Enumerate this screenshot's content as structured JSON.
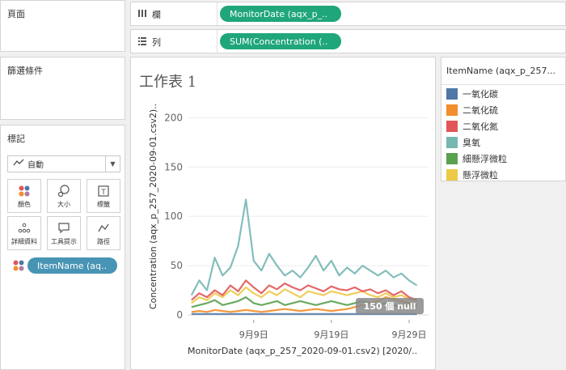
{
  "pages": {
    "title": "頁面"
  },
  "filters": {
    "title": "篩選條件"
  },
  "marks": {
    "title": "標記",
    "type": "自動",
    "buttons": [
      {
        "label": "顏色",
        "icon": "color-icon"
      },
      {
        "label": "大小",
        "icon": "size-icon"
      },
      {
        "label": "標籤",
        "icon": "label-icon"
      },
      {
        "label": "詳細資料",
        "icon": "detail-icon"
      },
      {
        "label": "工具提示",
        "icon": "tooltip-icon"
      },
      {
        "label": "路徑",
        "icon": "path-icon"
      }
    ],
    "color_pill": "ItemName (aq.."
  },
  "columns": {
    "label": "欄",
    "pill": "MonitorDate (aqx_p_.."
  },
  "rows": {
    "label": "列",
    "pill": "SUM(Concentration (.."
  },
  "sheet": {
    "title": "工作表 1",
    "null_badge": "150 個 null"
  },
  "legend": {
    "title": "ItemName (aqx_p_257...",
    "items": [
      {
        "label": "一氧化碳",
        "color": "#4e79a7"
      },
      {
        "label": "二氧化硫",
        "color": "#f28e2b"
      },
      {
        "label": "二氧化氮",
        "color": "#e15759"
      },
      {
        "label": "臭氧",
        "color": "#76b7b2"
      },
      {
        "label": "細懸浮微粒",
        "color": "#59a14f"
      },
      {
        "label": "懸浮微粒",
        "color": "#edc948"
      }
    ]
  },
  "chart_data": {
    "type": "line",
    "xlabel": "MonitorDate (aqx_p_257_2020-09-01.csv2) [2020/..",
    "ylabel": "Concentration (aqx_p_257_2020-09-01.csv2)..",
    "x_ticks": [
      "9月9日",
      "9月19日",
      "9月29日"
    ],
    "y_ticks": [
      0,
      50,
      100,
      150,
      200
    ],
    "ylim": [
      0,
      220
    ],
    "x": [
      1,
      2,
      3,
      4,
      5,
      6,
      7,
      8,
      9,
      10,
      11,
      12,
      13,
      14,
      15,
      16,
      17,
      18,
      19,
      20,
      21,
      22,
      23,
      24,
      25,
      26,
      27,
      28,
      29,
      30
    ],
    "x_tick_positions": [
      9,
      19,
      29
    ],
    "series": [
      {
        "name": "一氧化碳",
        "values": [
          1,
          1,
          1,
          1,
          1,
          1,
          1,
          1,
          1,
          1,
          1,
          1,
          1,
          1,
          1,
          1,
          1,
          1,
          1,
          1,
          1,
          1,
          1,
          1,
          1,
          1,
          1,
          1,
          1,
          1
        ]
      },
      {
        "name": "二氧化硫",
        "values": [
          3,
          4,
          3,
          5,
          4,
          3,
          4,
          5,
          4,
          3,
          4,
          5,
          6,
          5,
          4,
          5,
          6,
          5,
          4,
          5,
          6,
          8,
          10,
          12,
          14,
          18,
          16,
          14,
          12,
          10
        ]
      },
      {
        "name": "二氧化氮",
        "values": [
          15,
          22,
          18,
          25,
          20,
          30,
          24,
          35,
          28,
          22,
          30,
          26,
          32,
          28,
          25,
          30,
          27,
          24,
          29,
          26,
          25,
          28,
          24,
          26,
          22,
          25,
          20,
          24,
          18,
          15
        ]
      },
      {
        "name": "臭氧",
        "values": [
          20,
          35,
          25,
          58,
          40,
          48,
          70,
          117,
          55,
          45,
          62,
          50,
          40,
          45,
          38,
          48,
          60,
          45,
          55,
          40,
          48,
          42,
          50,
          45,
          40,
          45,
          38,
          42,
          35,
          30
        ]
      },
      {
        "name": "細懸浮微粒",
        "values": [
          8,
          10,
          12,
          15,
          10,
          12,
          14,
          18,
          12,
          10,
          12,
          14,
          10,
          12,
          14,
          12,
          10,
          12,
          14,
          12,
          10,
          12,
          14,
          12,
          10,
          12,
          10,
          8,
          10,
          8
        ]
      },
      {
        "name": "懸浮微粒",
        "values": [
          12,
          18,
          15,
          22,
          18,
          25,
          20,
          28,
          22,
          18,
          24,
          20,
          26,
          22,
          18,
          24,
          22,
          20,
          24,
          22,
          20,
          22,
          24,
          20,
          18,
          22,
          18,
          20,
          16,
          14
        ]
      }
    ],
    "grid": true,
    "legend": "right"
  }
}
